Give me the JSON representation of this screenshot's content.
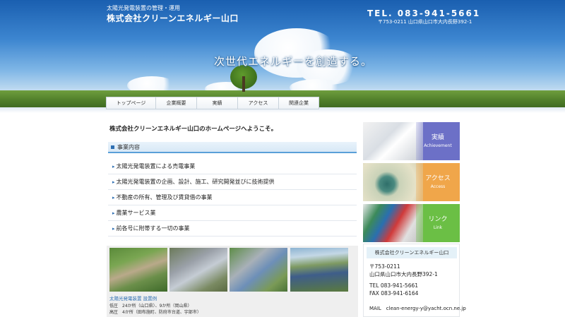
{
  "header": {
    "subtitle": "太陽光発電装置の管理・運用",
    "company": "株式会社クリーンエネルギー山口",
    "tel": "TEL. 083-941-5661",
    "address": "〒753-0211 山口県山口市大内長野392-1",
    "tagline": "次世代エネルギーを創造する。"
  },
  "nav": {
    "items": [
      "トップページ",
      "企業概要",
      "実績",
      "アクセス",
      "関連企業"
    ]
  },
  "main": {
    "welcome": "株式会社クリーンエネルギー山口のホームページへようこそ。",
    "section_title": "事業内容",
    "business": [
      "太陽光発電装置による売電事業",
      "太陽光発電装置の企画、設計、施工、研究開発並びに技術提供",
      "不動産の所有、管理及び賃貸借の事業",
      "農業サービス業",
      "前各号に附帯する一切の事業"
    ],
    "photos": {
      "caption": "太陽光発電装置 設置例",
      "line1": "低圧　24か所（山口県）、9か所（岡山県）",
      "line2": "高圧　4か所（田布施町、防府市台道、宇部市）"
    }
  },
  "sidebar": {
    "banners": [
      {
        "jp": "実績",
        "en": "Achievement"
      },
      {
        "jp": "アクセス",
        "en": "Access"
      },
      {
        "jp": "リンク",
        "en": "Link"
      }
    ],
    "contact": {
      "title": "株式会社クリーンエネルギー山口",
      "zip": "〒753-0211",
      "address": "山口県山口市大内長野392-1",
      "tel": "TEL 083-941-5661",
      "fax": "FAX 083-941-6164",
      "mail": "MAIL　clean-energy-y@yacht.ocn.ne.jp"
    }
  },
  "colors": {
    "accent": "#2e6fb3",
    "banner_achievement": "#6c70c7",
    "banner_access": "#f0a64a",
    "banner_link": "#6bbf45"
  }
}
